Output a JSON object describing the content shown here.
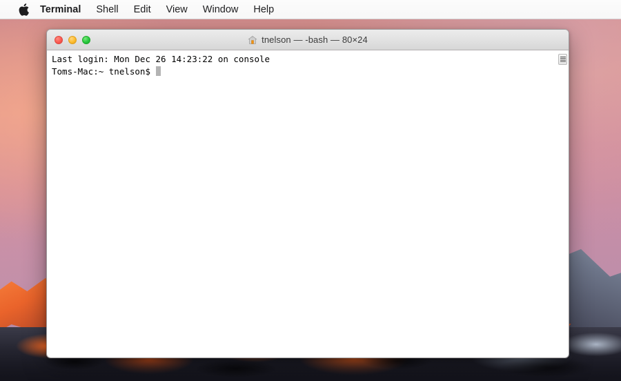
{
  "menubar": {
    "apple_icon": "apple-logo-icon",
    "items": [
      {
        "label": "Terminal",
        "bold": true
      },
      {
        "label": "Shell",
        "bold": false
      },
      {
        "label": "Edit",
        "bold": false
      },
      {
        "label": "View",
        "bold": false
      },
      {
        "label": "Window",
        "bold": false
      },
      {
        "label": "Help",
        "bold": false
      }
    ]
  },
  "window": {
    "title": "tnelson — -bash — 80×24",
    "title_icon": "home-folder-icon",
    "controls": {
      "close_label": "Close",
      "minimize_label": "Minimize",
      "zoom_label": "Zoom"
    }
  },
  "terminal": {
    "lines": [
      "Last login: Mon Dec 26 14:23:22 on console",
      "Toms-Mac:~ tnelson$ "
    ],
    "prompt_line": "Toms-Mac:~ tnelson$ ",
    "cursor": "block-cursor",
    "scroll_indicator": "scroll-thumb-icon"
  },
  "colors": {
    "traffic_close": "#fb5a51",
    "traffic_minimize": "#fdbc2c",
    "traffic_zoom": "#28c83f",
    "menubar_bg": "#fafafa",
    "titlebar_bg": "#e2e2e2",
    "terminal_bg": "#ffffff",
    "terminal_fg": "#000000",
    "cursor_color": "#b3b3b3",
    "wallpaper_sky": "#c98fa6",
    "wallpaper_rock": "#23232e",
    "wallpaper_sunlit": "#ff6a22"
  }
}
